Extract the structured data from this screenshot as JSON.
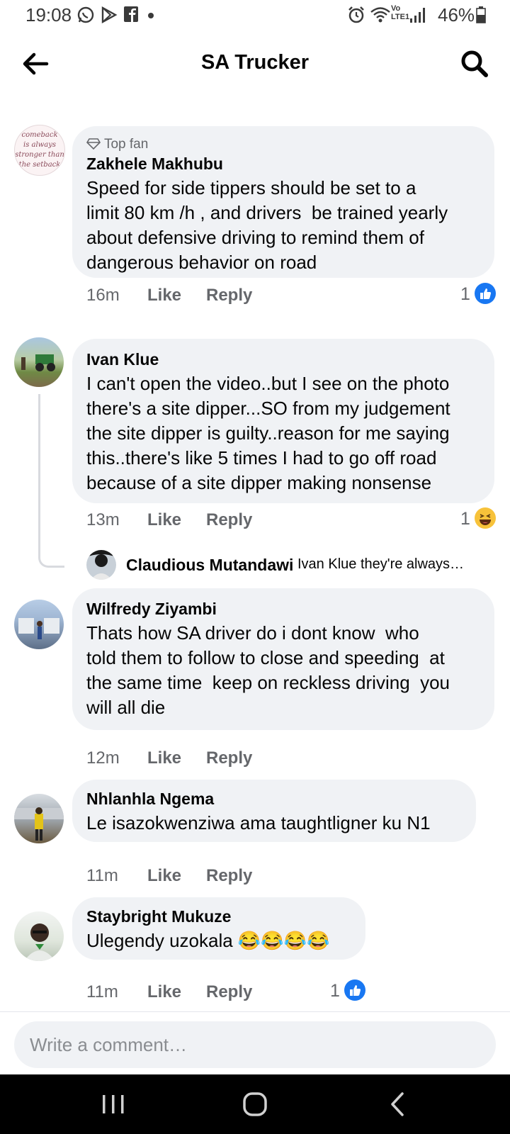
{
  "status_bar": {
    "time": "19:08",
    "battery_pct": "46%",
    "icons": [
      "whatsapp-icon",
      "play-store-icon",
      "facebook-icon",
      "dot-icon",
      "alarm-icon",
      "wifi-icon",
      "volte-icon",
      "signal-icon",
      "battery-icon"
    ]
  },
  "header": {
    "title": "SA Trucker",
    "back_icon": "arrow-left-icon",
    "search_icon": "search-icon"
  },
  "comments": [
    {
      "badge": "Top fan",
      "name": "Zakhele Makhubu",
      "text": "Speed for side tippers should be set to a\nlimit 80 km /h , and drivers  be trained yearly\nabout defensive driving to remind them of\ndangerous behavior on road",
      "time": "16m",
      "like": "Like",
      "reply": "Reply",
      "reaction_count": "1",
      "reaction_type": "like"
    },
    {
      "name": "Ivan Klue",
      "text": "I can't open the video..but I see on the photo\nthere's a site dipper...SO from my judgement\nthe site dipper is guilty..reason for me saying\nthis..there's like 5 times I had to go off road\nbecause of a site dipper making nonsense",
      "time": "13m",
      "like": "Like",
      "reply": "Reply",
      "reaction_count": "1",
      "reaction_type": "haha"
    },
    {
      "name": "Wilfredy Ziyambi",
      "text": "Thats how SA driver do i dont know  who\ntold them to follow to close and speeding  at\nthe same time  keep on reckless driving  you\nwill all die",
      "time": "12m",
      "like": "Like",
      "reply": "Reply"
    },
    {
      "name": "Nhlanhla Ngema",
      "text": "Le isazokwenziwa ama taughtligner ku N1",
      "time": "11m",
      "like": "Like",
      "reply": "Reply"
    },
    {
      "name": "Staybright Mukuze",
      "text": "Ulegendy uzokala 😂😂😂😂",
      "time": "11m",
      "like": "Like",
      "reply": "Reply",
      "reaction_count": "1",
      "reaction_type": "like"
    }
  ],
  "reply_preview": {
    "name": "Claudious Mutandawi",
    "text": "Ivan Klue they're always…"
  },
  "avatar_text": "is comeback is always stronger than the setback",
  "composer": {
    "placeholder": "Write a comment…"
  },
  "nav_bar": {
    "icons": [
      "recent-apps-icon",
      "home-icon",
      "back-icon"
    ]
  },
  "colors": {
    "bubble": "#f0f2f5",
    "like_blue": "#1877f2",
    "meta_gray": "#65676b",
    "haha_yellow": "#f7c23a"
  }
}
